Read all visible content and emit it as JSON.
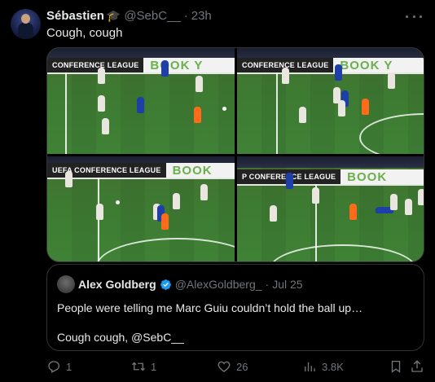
{
  "tweet": {
    "author_name": "Sébastien",
    "author_badge": "graduation-cap-emoji",
    "handle": "@SebC__",
    "separator": "·",
    "time": "23h",
    "text": "Cough, cough",
    "media": [
      {
        "board_left": "CONFERENCE LEAGUE",
        "board_right": "BOOK Y"
      },
      {
        "board_left": "CONFERENCE LEAGUE",
        "board_right": "BOOK Y"
      },
      {
        "board_left": "UEFA CONFERENCE LEAGUE",
        "board_right": "BOOK"
      },
      {
        "board_left": "P  CONFERENCE LEAGUE",
        "board_right": "BOOK"
      }
    ]
  },
  "quote": {
    "author_name": "Alex Goldberg",
    "verified": true,
    "handle": "@AlexGoldberg_",
    "separator": "·",
    "date": "Jul 25",
    "text": "People were telling me Marc Guiu couldn’t hold the ball up…\n\nCough cough, @SebC__"
  },
  "actions": {
    "replies": "1",
    "reposts": "1",
    "likes": "26",
    "views": "3.8K"
  },
  "colors": {
    "background": "#000000",
    "text": "#e7e9ea",
    "muted": "#71767b",
    "border": "#2f3336",
    "verified": "#1d9bf0"
  }
}
